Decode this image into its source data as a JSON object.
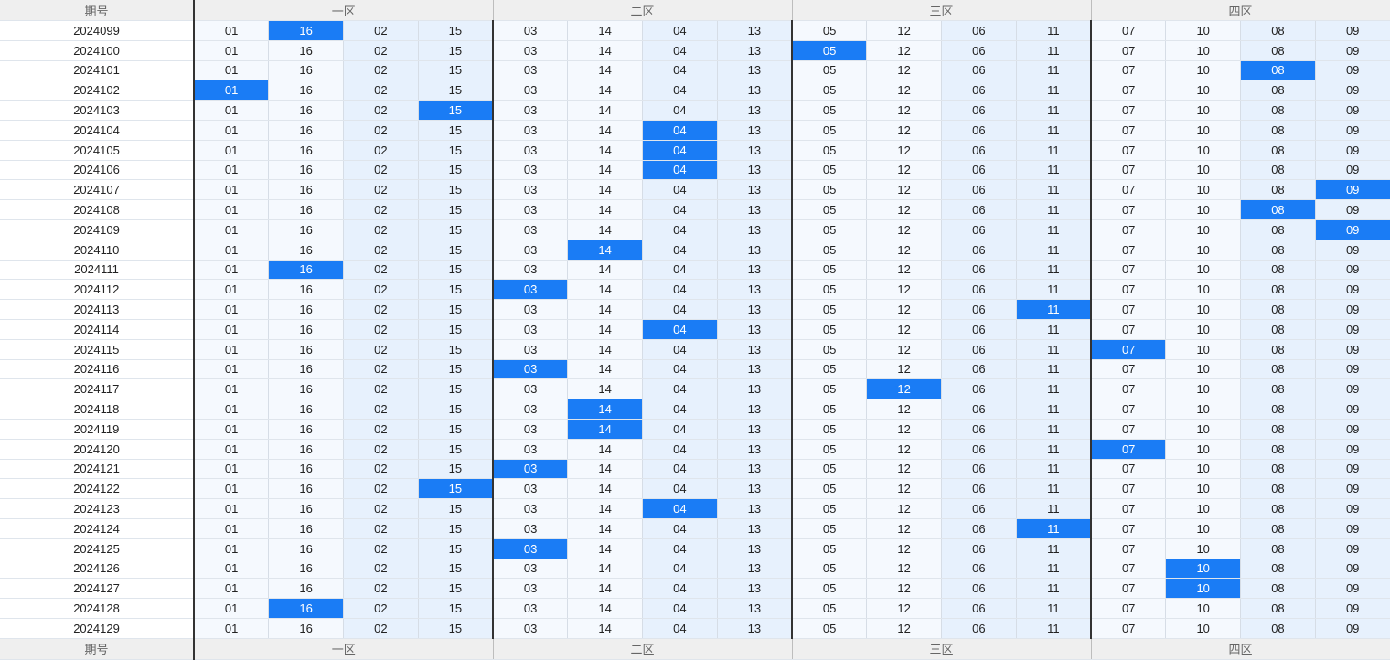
{
  "header": {
    "period_label": "期号",
    "zones": [
      "一区",
      "二区",
      "三区",
      "四区"
    ]
  },
  "columns": [
    "01",
    "16",
    "02",
    "15",
    "03",
    "14",
    "04",
    "13",
    "05",
    "12",
    "06",
    "11",
    "07",
    "10",
    "08",
    "09"
  ],
  "colors": {
    "highlight": "#1a7cf5",
    "cell_light": "#f5f9fe",
    "cell_tint": "#e7f1fd",
    "header_bg": "#efefef"
  },
  "rows": [
    {
      "period": "2024099",
      "hit": 1
    },
    {
      "period": "2024100",
      "hit": 8
    },
    {
      "period": "2024101",
      "hit": 14
    },
    {
      "period": "2024102",
      "hit": 0
    },
    {
      "period": "2024103",
      "hit": 3
    },
    {
      "period": "2024104",
      "hit": 6
    },
    {
      "period": "2024105",
      "hit": 6
    },
    {
      "period": "2024106",
      "hit": 6
    },
    {
      "period": "2024107",
      "hit": 15
    },
    {
      "period": "2024108",
      "hit": 14
    },
    {
      "period": "2024109",
      "hit": 15
    },
    {
      "period": "2024110",
      "hit": 5
    },
    {
      "period": "2024111",
      "hit": 1
    },
    {
      "period": "2024112",
      "hit": 4
    },
    {
      "period": "2024113",
      "hit": 11
    },
    {
      "period": "2024114",
      "hit": 6
    },
    {
      "period": "2024115",
      "hit": 12
    },
    {
      "period": "2024116",
      "hit": 4
    },
    {
      "period": "2024117",
      "hit": 9
    },
    {
      "period": "2024118",
      "hit": 5
    },
    {
      "period": "2024119",
      "hit": 5
    },
    {
      "period": "2024120",
      "hit": 12
    },
    {
      "period": "2024121",
      "hit": 4
    },
    {
      "period": "2024122",
      "hit": 3
    },
    {
      "period": "2024123",
      "hit": 6
    },
    {
      "period": "2024124",
      "hit": 11
    },
    {
      "period": "2024125",
      "hit": 4
    },
    {
      "period": "2024126",
      "hit": 13
    },
    {
      "period": "2024127",
      "hit": 13
    },
    {
      "period": "2024128",
      "hit": 1
    },
    {
      "period": "2024129",
      "hit": null
    }
  ]
}
